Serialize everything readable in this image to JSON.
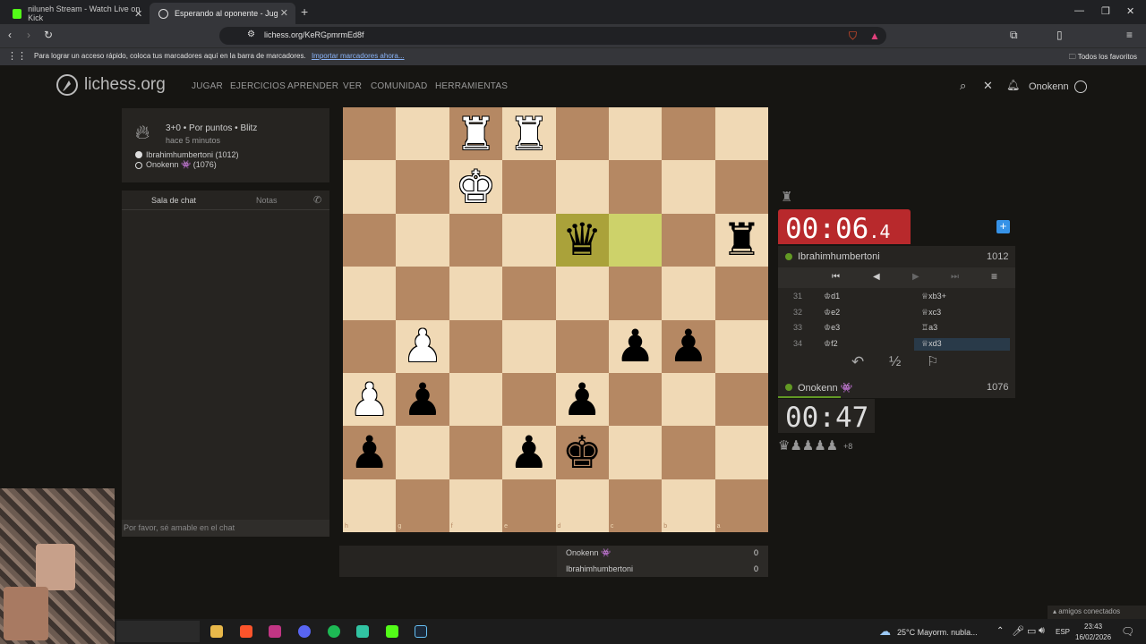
{
  "browser": {
    "tabs": [
      {
        "title": "niluneh Stream - Watch Live on Kick",
        "active": false
      },
      {
        "title": "Esperando al oponente - Jug",
        "active": true
      }
    ],
    "url": "lichess.org/KeRGpmrmEd8f",
    "bookmarks_hint": "Para lograr un acceso rápido, coloca tus marcadores aquí en la barra de marcadores.",
    "bookmarks_link": "Importar marcadores ahora...",
    "bookmarks_all": "Todos los favoritos"
  },
  "site": {
    "logo": "lichess.org",
    "menu": [
      "JUGAR",
      "EJERCICIOS",
      "APRENDER",
      "VER",
      "COMUNIDAD",
      "HERRAMIENTAS"
    ],
    "username": "Onokenn"
  },
  "game": {
    "mode": "3+0 • Por puntos • Blitz",
    "time_ago": "hace 5 minutos",
    "white_player": "Ibrahimhumbertoni (1012)",
    "black_player": "Onokenn 👾 (1076)"
  },
  "chat": {
    "tab_chat": "Sala de chat",
    "tab_notes": "Notas",
    "placeholder": "Por favor, sé amable en el chat"
  },
  "board": {
    "orientation": "black",
    "files_bottom": [
      "h",
      "g",
      "f",
      "e",
      "d",
      "c",
      "b",
      "a"
    ],
    "ranks_right": [
      "1",
      "2",
      "3",
      "4",
      "5",
      "6",
      "7",
      "8"
    ],
    "highlight": [
      "d3",
      "c3"
    ],
    "pieces": [
      {
        "square": "f1",
        "piece": "R",
        "color": "w"
      },
      {
        "square": "e1",
        "piece": "R",
        "color": "w"
      },
      {
        "square": "f2",
        "piece": "K",
        "color": "w"
      },
      {
        "square": "d3",
        "piece": "Q",
        "color": "b"
      },
      {
        "square": "a3",
        "piece": "R",
        "color": "b"
      },
      {
        "square": "g5",
        "piece": "P",
        "color": "w"
      },
      {
        "square": "c5",
        "piece": "P",
        "color": "b"
      },
      {
        "square": "b5",
        "piece": "P",
        "color": "b"
      },
      {
        "square": "h6",
        "piece": "P",
        "color": "w"
      },
      {
        "square": "g6",
        "piece": "P",
        "color": "b"
      },
      {
        "square": "d6",
        "piece": "P",
        "color": "b"
      },
      {
        "square": "h7",
        "piece": "P",
        "color": "b"
      },
      {
        "square": "e7",
        "piece": "P",
        "color": "b"
      },
      {
        "square": "d7",
        "piece": "K",
        "color": "b"
      }
    ]
  },
  "clocks": {
    "top_main": "00:06",
    "top_tenths": ".4",
    "bottom": "00:47"
  },
  "players": {
    "top_name": "Ibrahimhumbertoni",
    "top_rating": "1012",
    "bottom_name": "Onokenn 👾",
    "bottom_rating": "1076",
    "material_diff": "+8"
  },
  "moves": [
    {
      "n": "31",
      "w": "♔d1",
      "b": "♕xb3+"
    },
    {
      "n": "32",
      "w": "♔e2",
      "b": "♕xc3"
    },
    {
      "n": "33",
      "w": "♔e3",
      "b": "♖a3"
    },
    {
      "n": "34",
      "w": "♔f2",
      "b": "♕xd3"
    }
  ],
  "score": {
    "p1_name": "Onokenn 👾",
    "p1_score": "0",
    "p2_name": "Ibrahimhumbertoni",
    "p2_score": "0"
  },
  "taskbar": {
    "weather": "25°C  Mayorm. nubla...",
    "lang": "ESP",
    "time": "23:43",
    "date": "16/02/2026",
    "friends": "amigos conectados"
  },
  "colors": {
    "light_square": "#f0d9b5",
    "dark_square": "#b58863",
    "highlight_light": "#cdd26a",
    "highlight_dark": "#aaa23a",
    "clock_low": "#b8292c"
  }
}
